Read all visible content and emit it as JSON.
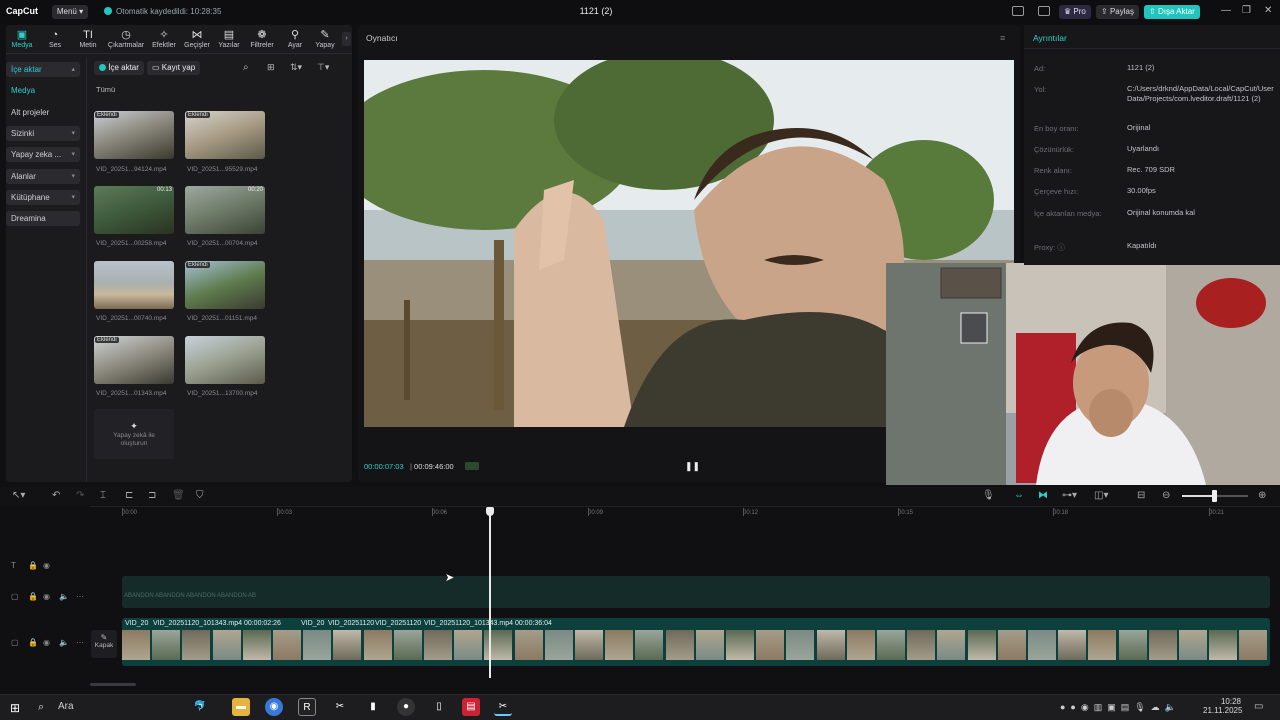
{
  "titlebar": {
    "logo": "CapCut",
    "menu_label": "Menü",
    "autosave": "Otomatik kaydedildi: 10:28:35",
    "project_title": "1121 (2)",
    "pro_label": "Pro",
    "share_label": "Paylaş",
    "export_label": "Dışa Aktar"
  },
  "toolbar": {
    "items": [
      {
        "label": "Medya",
        "icon": "media-icon"
      },
      {
        "label": "Ses",
        "icon": "audio-icon"
      },
      {
        "label": "Metin",
        "icon": "text-icon"
      },
      {
        "label": "Çıkartmalar",
        "icon": "sticker-icon"
      },
      {
        "label": "Efektler",
        "icon": "effects-icon"
      },
      {
        "label": "Geçişler",
        "icon": "transitions-icon"
      },
      {
        "label": "Yazılar",
        "icon": "captions-icon"
      },
      {
        "label": "Filtreler",
        "icon": "filters-icon"
      },
      {
        "label": "Ayar",
        "icon": "adjust-icon"
      },
      {
        "label": "Yapay",
        "icon": "ai-icon"
      }
    ]
  },
  "sidebar": {
    "items": [
      {
        "label": "İçe aktar",
        "selected": true
      },
      {
        "label": "Medya"
      },
      {
        "label": "Alt projeler"
      },
      {
        "label": "Sizinki"
      },
      {
        "label": "Yapay zeka ..."
      },
      {
        "label": "Alanlar"
      },
      {
        "label": "Kütüphane"
      },
      {
        "label": "Dreamina"
      }
    ]
  },
  "media": {
    "import_button": "İçe aktar",
    "record_button": "Kayıt yap",
    "filter_all": "Tümü",
    "clips": [
      {
        "name": "VID_20251...94124.mp4",
        "badge": "Eklendi",
        "duration": ""
      },
      {
        "name": "VID_20251...95529.mp4",
        "badge": "Eklendi",
        "duration": ""
      },
      {
        "name": "VID_20251...00258.mp4",
        "badge": "",
        "duration": "00:13"
      },
      {
        "name": "VID_20251...00704.mp4",
        "badge": "",
        "duration": "00:20"
      },
      {
        "name": "VID_20251...00740.mp4",
        "badge": "",
        "duration": ""
      },
      {
        "name": "VID_20251...01151.mp4",
        "badge": "Eklendi",
        "duration": ""
      },
      {
        "name": "VID_20251...01343.mp4",
        "badge": "Eklendi",
        "duration": ""
      },
      {
        "name": "VID_20251...13700.mp4",
        "badge": "",
        "duration": ""
      }
    ],
    "ai_create_label": "Yapay zekâ ile oluşturun"
  },
  "player": {
    "title": "Oynatıcı",
    "current_time": "00:00:07:03",
    "total_time": "00:09:46:00"
  },
  "details": {
    "title": "Ayrıntılar",
    "rows": [
      {
        "label": "Ad:",
        "value": "1121 (2)"
      },
      {
        "label": "Yol:",
        "value": "C:/Users/drknd/AppData/Local/CapCut/User Data/Projects/com.lveditor.draft/1121 (2)"
      },
      {
        "label": "En boy oranı:",
        "value": "Orijinal"
      },
      {
        "label": "Çözünürlük:",
        "value": "Uyarlandı"
      },
      {
        "label": "Renk alanı:",
        "value": "Rec. 709 SDR"
      },
      {
        "label": "Çerçeve hızı:",
        "value": "30.00fps"
      },
      {
        "label": "İçe aktarılan medya:",
        "value": "Orijinal konumda kal"
      },
      {
        "label": "Proxy:",
        "value": "Kapatıldı"
      }
    ]
  },
  "timeline": {
    "ticks": [
      "00:00",
      "00:03",
      "00:06",
      "00:09",
      "00:12",
      "00:15",
      "00:18",
      "00:21"
    ],
    "cover_label": "Kapak",
    "clips": [
      {
        "label": "VID_20"
      },
      {
        "label": "VID_20251120_101343.mp4  00:00:02:26"
      },
      {
        "label": "VID_20"
      },
      {
        "label": "VID_20251120"
      },
      {
        "label": "VID_20251120"
      },
      {
        "label": "VID_20251120_101343.mp4  00:00:36:04"
      }
    ],
    "audio_label": "ABANDON ABANDON ABANDON ABANDON AB"
  },
  "taskbar": {
    "search_placeholder": "Ara",
    "clock_time": "10:28",
    "clock_date": "21.11.2025"
  }
}
